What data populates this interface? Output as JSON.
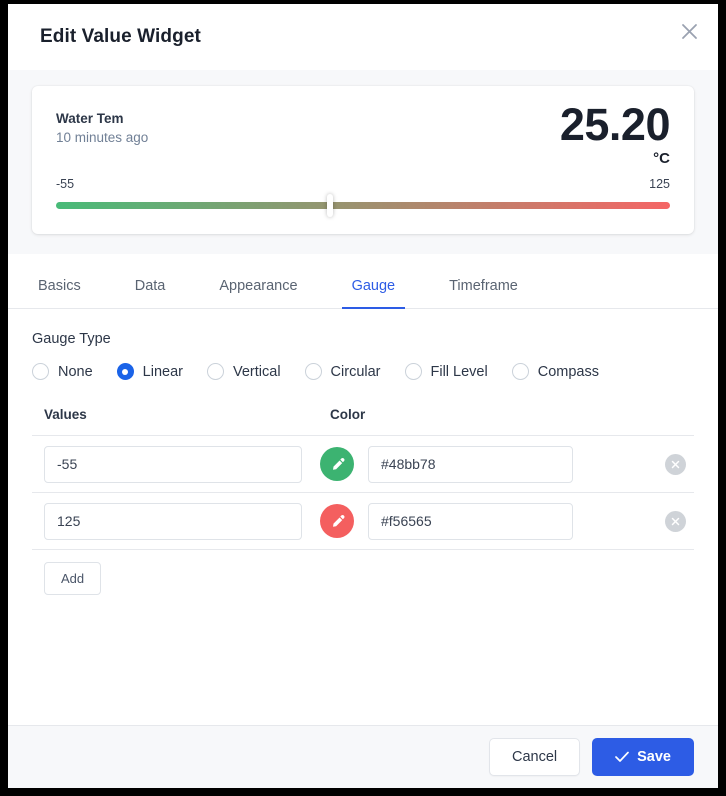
{
  "dialog": {
    "title": "Edit Value Widget",
    "close_icon": "close-icon"
  },
  "preview": {
    "name": "Water Tem",
    "timestamp": "10 minutes ago",
    "value": "25.20",
    "unit": "°C",
    "gauge": {
      "min_label": "-55",
      "max_label": "125",
      "min": -55,
      "max": 125,
      "current": 25.2,
      "thumb_percent": 44.6,
      "start_color": "#48bb78",
      "end_color": "#f56565"
    }
  },
  "tabs": [
    {
      "label": "Basics",
      "active": false
    },
    {
      "label": "Data",
      "active": false
    },
    {
      "label": "Appearance",
      "active": false
    },
    {
      "label": "Gauge",
      "active": true
    },
    {
      "label": "Timeframe",
      "active": false
    }
  ],
  "gauge_type": {
    "label": "Gauge Type",
    "options": [
      {
        "label": "None",
        "selected": false
      },
      {
        "label": "Linear",
        "selected": true
      },
      {
        "label": "Vertical",
        "selected": false
      },
      {
        "label": "Circular",
        "selected": false
      },
      {
        "label": "Fill Level",
        "selected": false
      },
      {
        "label": "Compass",
        "selected": false
      }
    ]
  },
  "values_table": {
    "headers": {
      "values": "Values",
      "color": "Color"
    },
    "rows": [
      {
        "value": "-55",
        "color_hex": "#48bb78",
        "swatch_color": "#3cb371"
      },
      {
        "value": "125",
        "color_hex": "#f56565",
        "swatch_color": "#f45f5f"
      }
    ],
    "add_label": "Add"
  },
  "footer": {
    "cancel_label": "Cancel",
    "save_label": "Save"
  },
  "accent_color": "#2d5ce5"
}
